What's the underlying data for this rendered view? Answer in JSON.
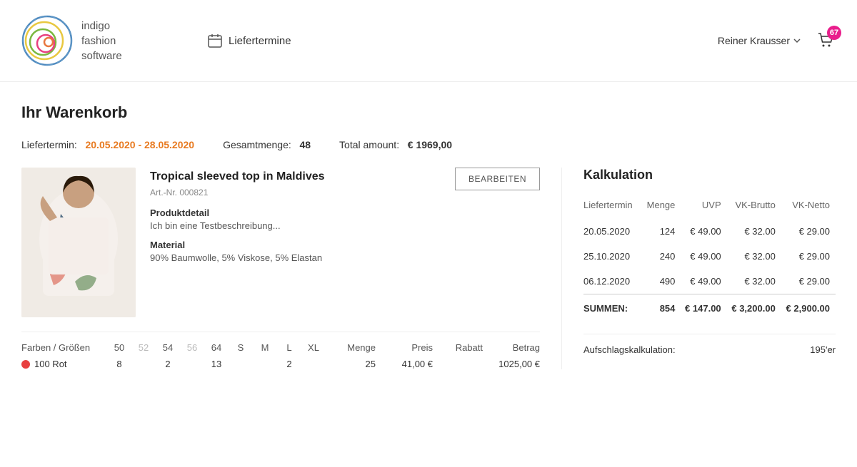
{
  "header": {
    "logo_text_line1": "indigo",
    "logo_text_line2": "fashion",
    "logo_text_line3": "software",
    "nav_liefertermine": "Liefertermine",
    "user_name": "Reiner Krausser",
    "cart_badge": "67"
  },
  "page": {
    "title": "Ihr Warenkorb",
    "liefertermin_label": "Liefertermin:",
    "liefertermin_value": "20.05.2020 - 28.05.2020",
    "gesamtmenge_label": "Gesamtmenge:",
    "gesamtmenge_value": "48",
    "total_label": "Total amount:",
    "total_value": "€ 1969,00"
  },
  "product": {
    "name": "Tropical sleeved top in Maldives",
    "artnr": "Art.-Nr. 000821",
    "bearbeiten_label": "BEARBEITEN",
    "section1_title": "Produktdetail",
    "section1_value": "Ich bin eine Testbeschreibung...",
    "section2_title": "Material",
    "section2_value": "90% Baumwolle, 5% Viskose, 5% Elastan"
  },
  "size_table": {
    "header": {
      "farben_groessen": "Farben / Größen",
      "sizes": [
        "50",
        "52",
        "54",
        "56",
        "64",
        "S",
        "M",
        "L",
        "XL"
      ],
      "sizes_active": [
        true,
        false,
        true,
        false,
        true,
        true,
        true,
        true,
        true
      ],
      "menge": "Menge",
      "preis": "Preis",
      "rabatt": "Rabatt",
      "betrag": "Betrag"
    },
    "rows": [
      {
        "color_hex": "#e84040",
        "color_name": "100 Rot",
        "size_values": [
          "8",
          "",
          "2",
          "",
          "13",
          "",
          "",
          "2",
          ""
        ],
        "menge": "25",
        "preis": "41,00 €",
        "rabatt": "",
        "betrag": "1025,00 €"
      }
    ]
  },
  "kalkulation": {
    "title": "Kalkulation",
    "headers": [
      "Liefertermin",
      "Menge",
      "UVP",
      "VK-Brutto",
      "VK-Netto"
    ],
    "rows": [
      {
        "liefertermin": "20.05.2020",
        "menge": "124",
        "uvp": "€ 49.00",
        "vk_brutto": "€ 32.00",
        "vk_netto": "€ 29.00"
      },
      {
        "liefertermin": "25.10.2020",
        "menge": "240",
        "uvp": "€ 49.00",
        "vk_brutto": "€ 32.00",
        "vk_netto": "€ 29.00"
      },
      {
        "liefertermin": "06.12.2020",
        "menge": "490",
        "uvp": "€ 49.00",
        "vk_brutto": "€ 32.00",
        "vk_netto": "€ 29.00"
      }
    ],
    "summen": {
      "label": "SUMMEN:",
      "menge": "854",
      "uvp": "€ 147.00",
      "vk_brutto": "€ 3,200.00",
      "vk_netto": "€ 2,900.00"
    },
    "aufschlag_label": "Aufschlagskalkulation:",
    "aufschlag_value": "195'er"
  }
}
